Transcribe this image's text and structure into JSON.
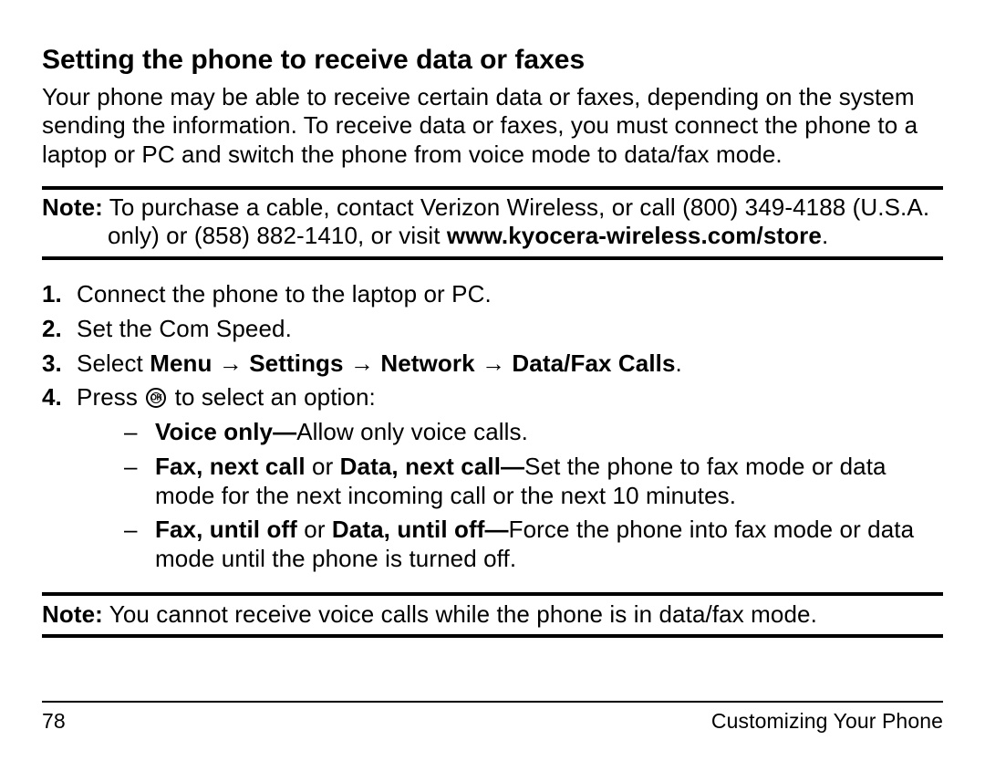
{
  "heading": "Setting the phone to receive data or faxes",
  "intro": "Your phone may be able to receive certain data or faxes, depending on the system sending the information. To receive data or faxes, you must connect the phone to a laptop or PC and switch the phone from voice mode to data/fax mode.",
  "note1": {
    "label": "Note:",
    "text_a": " To purchase a cable, contact Verizon Wireless, or call (800) 349-4188 (U.S.A. only) or (858) 882-1410, or visit ",
    "url": "www.kyocera-wireless.com/store",
    "period": "."
  },
  "steps": {
    "s1_num": "1.",
    "s1_text": "Connect the phone to the laptop or PC.",
    "s2_num": "2.",
    "s2_text": "Set the Com Speed.",
    "s3_num": "3.",
    "s3_pre": "Select ",
    "s3_menu": "Menu",
    "s3_arrow": " → ",
    "s3_settings": "Settings",
    "s3_network": "Network",
    "s3_datafax": "Data/Fax Calls",
    "s3_period": ".",
    "s4_num": "4.",
    "s4_pre": "Press ",
    "s4_post": " to select an option:"
  },
  "options": {
    "o1_b": "Voice only—",
    "o1_t": "Allow only voice calls.",
    "o2_b1": "Fax, next call",
    "o2_or": " or ",
    "o2_b2": "Data, next call—",
    "o2_t": "Set the phone to fax mode or data mode for the next incoming call or the next 10 minutes.",
    "o3_b1": "Fax, until off",
    "o3_or": " or ",
    "o3_b2": "Data, until off—",
    "o3_t": "Force the phone into fax mode or data mode until the phone is turned off."
  },
  "note2": {
    "label": "Note:",
    "text": " You cannot receive voice calls while the phone is in data/fax mode."
  },
  "footer": {
    "page": "78",
    "section": "Customizing Your Phone"
  }
}
